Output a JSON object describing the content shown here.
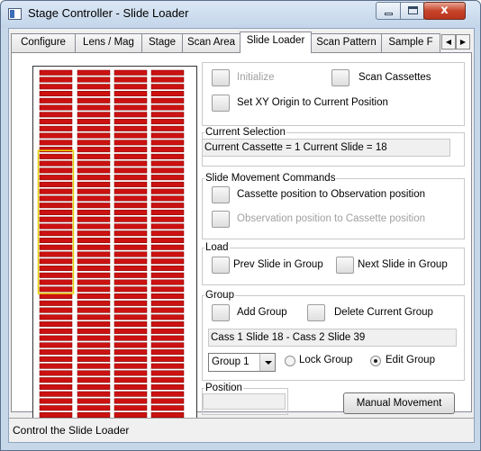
{
  "window": {
    "title": "Stage Controller - Slide Loader",
    "close_glyph": "x"
  },
  "tabs": [
    {
      "label": "Configure"
    },
    {
      "label": "Lens / Mag"
    },
    {
      "label": "Stage"
    },
    {
      "label": "Scan Area"
    },
    {
      "label": "Slide Loader",
      "active": true
    },
    {
      "label": "Scan Pattern"
    },
    {
      "label": "Sample F"
    }
  ],
  "tab_scroll": {
    "left": "◀",
    "right": "▶"
  },
  "slide_map": {
    "cassette_count": 4,
    "slides_per_cassette": 50,
    "slide_color": "#cc1111",
    "selection_color": "#e8d200",
    "selected_cassette": 1,
    "selected_slide_range": [
      18,
      39
    ]
  },
  "controls": {
    "initialize_label": "Initialize",
    "scan_cassettes_label": "Scan Cassettes",
    "set_origin_label": "Set XY Origin to Current Position"
  },
  "current_selection": {
    "title": "Current Selection",
    "text": "Current Cassette = 1   Current Slide = 18"
  },
  "movement": {
    "title": "Slide Movement Commands",
    "cassette_to_obs": "Cassette position to Observation position",
    "obs_to_cassette": "Observation position to Cassette position"
  },
  "load": {
    "title": "Load",
    "prev_label": "Prev Slide in Group",
    "next_label": "Next Slide in Group"
  },
  "group": {
    "title": "Group",
    "add_label": "Add Group",
    "delete_label": "Delete Current Group",
    "range_text": "Cass 1 Slide 18 - Cass 2 Slide 39",
    "selected_group": "Group 1",
    "lock_label": "Lock Group",
    "edit_label": "Edit Group",
    "mode": "edit"
  },
  "position": {
    "title": "Position",
    "value": ""
  },
  "manual_movement_label": "Manual Movement",
  "status": {
    "text": "Control the Slide Loader"
  }
}
